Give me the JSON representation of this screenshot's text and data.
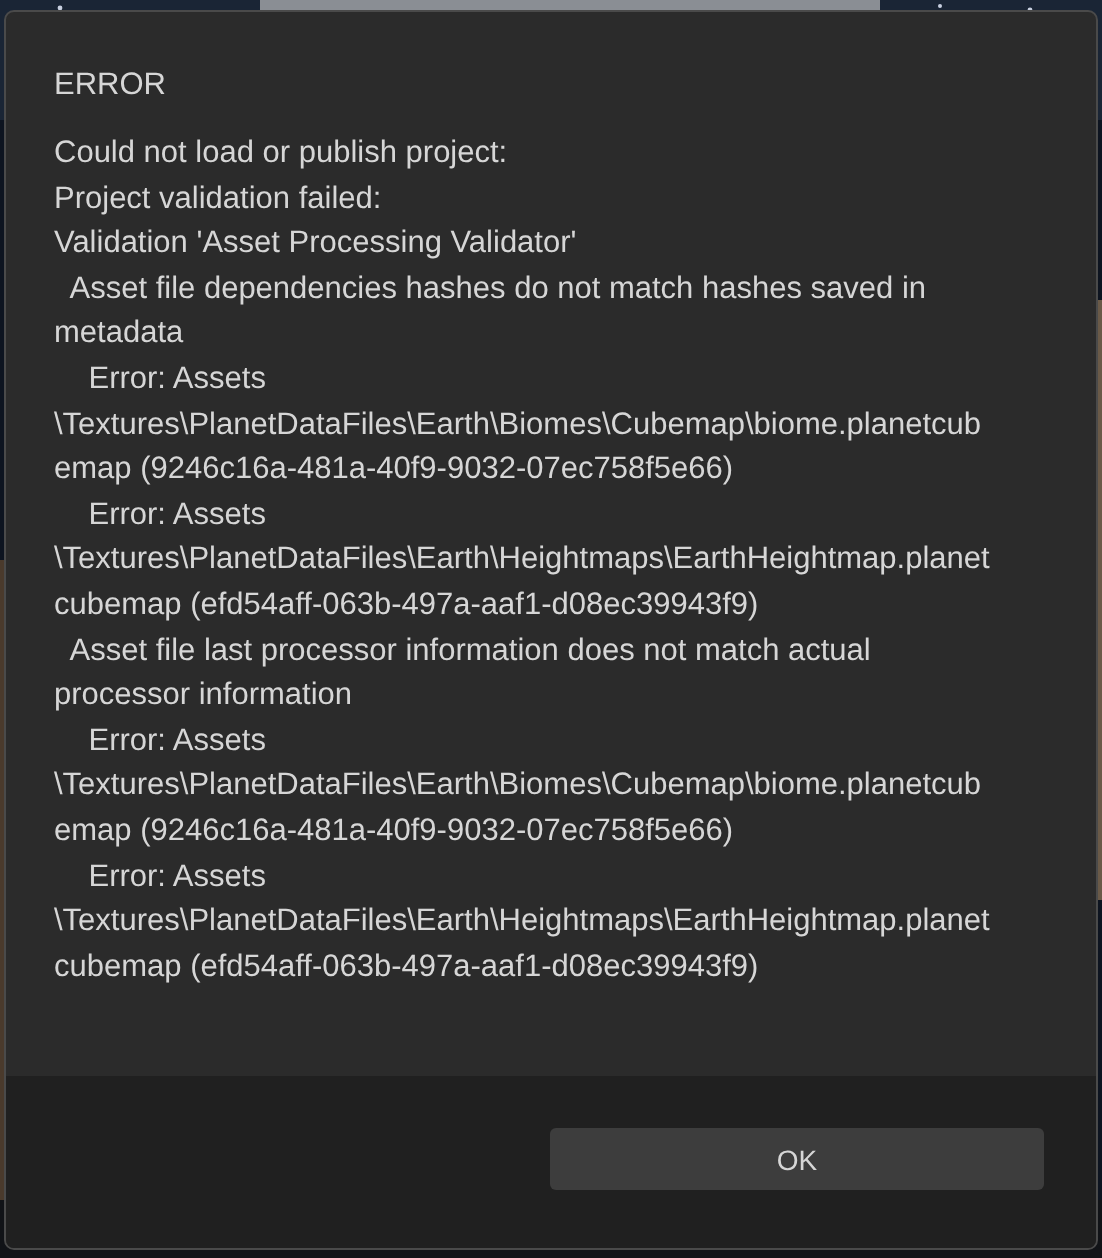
{
  "dialog": {
    "title": "ERROR",
    "message_lines": [
      "Could not load or publish project:",
      "Project validation failed:",
      "Validation 'Asset Processing Validator'",
      "  Asset file dependencies hashes do not match hashes saved in",
      "metadata",
      "    Error: Assets",
      "\\Textures\\PlanetDataFiles\\Earth\\Biomes\\Cubemap\\biome.planetcub",
      "emap (9246c16a-481a-40f9-9032-07ec758f5e66)",
      "    Error: Assets",
      "\\Textures\\PlanetDataFiles\\Earth\\Heightmaps\\EarthHeightmap.planet",
      "cubemap (efd54aff-063b-497a-aaf1-d08ec39943f9)",
      "  Asset file last processor information does not match actual",
      "processor information",
      "    Error: Assets",
      "\\Textures\\PlanetDataFiles\\Earth\\Biomes\\Cubemap\\biome.planetcub",
      "emap (9246c16a-481a-40f9-9032-07ec758f5e66)",
      "    Error: Assets",
      "\\Textures\\PlanetDataFiles\\Earth\\Heightmaps\\EarthHeightmap.planet",
      "cubemap (efd54aff-063b-497a-aaf1-d08ec39943f9)"
    ],
    "buttons": [
      "OK"
    ]
  }
}
